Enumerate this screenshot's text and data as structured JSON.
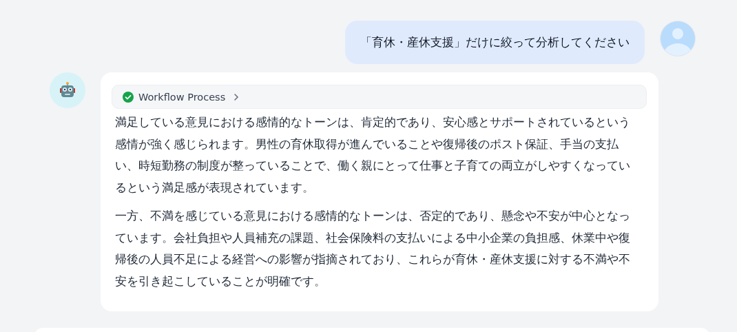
{
  "user_message": {
    "text": "「育休・産休支援」だけに絞って分析してください"
  },
  "assistant_message": {
    "workflow": {
      "label": "Workflow Process",
      "done": true
    },
    "paragraphs": [
      "満足している意見における感情的なトーンは、肯定的であり、安心感とサポートされているという感情が強く感じられます。男性の育休取得が進んでいることや復帰後のポスト保証、手当の支払い、時短勤務の制度が整っていることで、働く親にとって仕事と子育ての両立がしやすくなっているという満足感が表現されています。",
      "一方、不満を感じている意見における感情的なトーンは、否定的であり、懸念や不安が中心となっています。会社負担や人員補充の課題、社会保険料の支払いによる中小企業の負担感、休業中や復帰後の人員不足による経営への影響が指摘されており、これらが育休・産休支援に対する不満や不安を引き起こしていることが明確です。"
    ]
  }
}
